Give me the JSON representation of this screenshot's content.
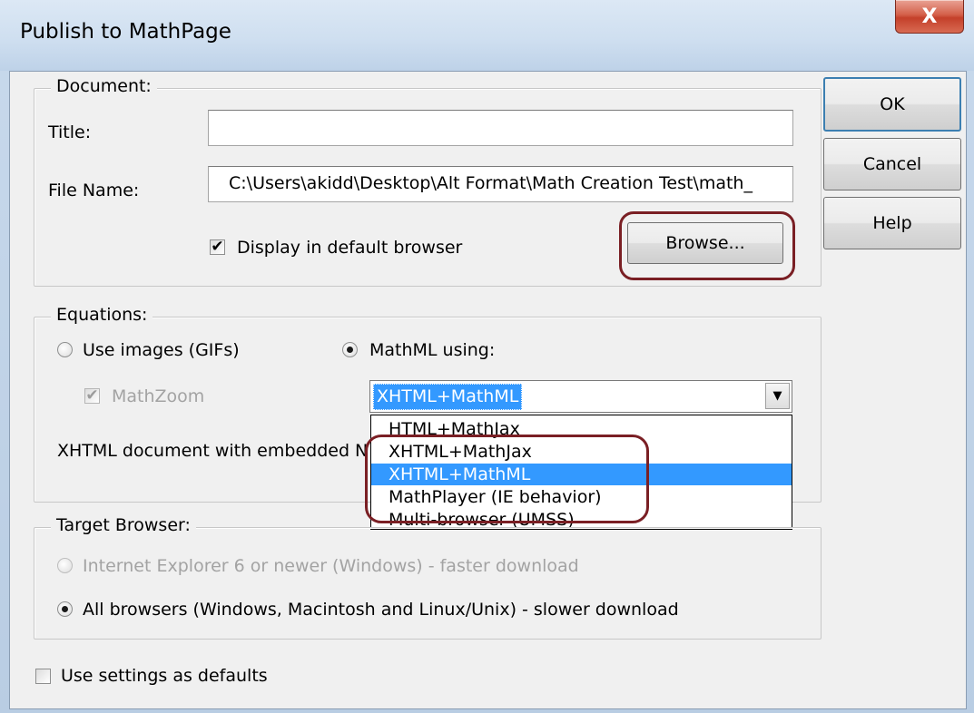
{
  "window": {
    "title": "Publish to MathPage",
    "close_glyph": "X"
  },
  "document": {
    "legend": "Document:",
    "title_label": "Title:",
    "title_value": "",
    "filename_label": "File Name:",
    "filename_value": "C:\\Users\\akidd\\Desktop\\Alt Format\\Math Creation Test\\math_",
    "display_label": "Display in default browser",
    "display_checked": true,
    "browse_label": "Browse..."
  },
  "equations": {
    "legend": "Equations:",
    "use_images_label": "Use images (GIFs)",
    "mathml_label": "MathML using:",
    "mathzoom_label": "MathZoom",
    "selected_format": "XHTML+MathML",
    "description": "XHTML document with embedded N",
    "options": [
      "HTML+MathJax",
      "XHTML+MathJax",
      "XHTML+MathML",
      "MathPlayer (IE behavior)",
      "Multi-browser (UMSS)"
    ],
    "selected_index": 2
  },
  "target_browser": {
    "legend": "Target Browser:",
    "ie_label": "Internet Explorer 6 or newer (Windows) - faster download",
    "all_label": "All browsers (Windows, Macintosh and Linux/Unix) - slower download"
  },
  "defaults_label": "Use settings as defaults",
  "buttons": {
    "ok": "OK",
    "cancel": "Cancel",
    "help": "Help"
  },
  "icons": {
    "check": "✔",
    "dropdown_arrow": "▼"
  },
  "colors": {
    "selection": "#3399ff",
    "callout": "#7a1f24"
  }
}
